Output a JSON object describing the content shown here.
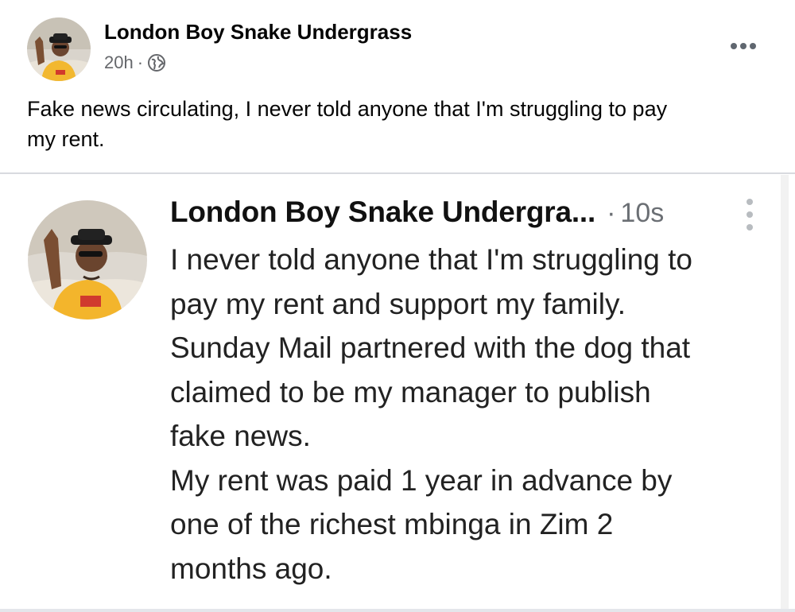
{
  "post": {
    "author": "London Boy Snake Undergrass",
    "time": "20h",
    "separator": "·",
    "audience_icon": "globe-icon",
    "more_icon": "more-horizontal-icon",
    "text_lines": [
      "Fake news circulating, I never told anyone that I'm struggling to pay",
      "my rent."
    ]
  },
  "tweet": {
    "author": "London Boy Snake Undergra...",
    "separator": "·",
    "time": "10s",
    "more_icon": "more-vertical-icon",
    "lines": [
      "I never told anyone that I'm struggling to",
      "pay my rent and support my family.",
      "Sunday Mail partnered with the dog that",
      "claimed to be my manager to publish",
      "fake news.",
      "My rent was paid 1 year in advance by",
      "one of the richest mbinga in Zim 2",
      "months ago."
    ]
  },
  "colors": {
    "name": "#050505",
    "meta": "#65676b",
    "divider": "#d8dadf",
    "tweet_text": "#222222",
    "tweet_meta": "#6b6f74"
  }
}
